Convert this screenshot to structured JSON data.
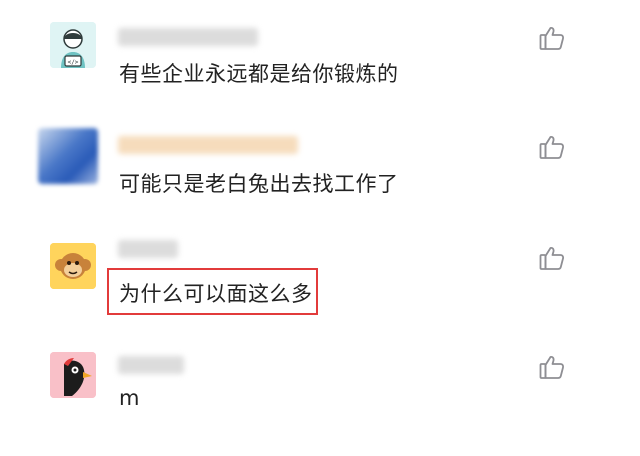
{
  "comments": [
    {
      "text": "有些企业永远都是给你锻炼的",
      "avatar_icon": "programmer-avatar-icon",
      "like_icon": "thumbs-up-icon"
    },
    {
      "text": "可能只是老白兔出去找工作了",
      "avatar_icon": "blurred-avatar-icon",
      "like_icon": "thumbs-up-icon"
    },
    {
      "text": "为什么可以面这么多",
      "avatar_icon": "monkey-avatar-icon",
      "like_icon": "thumbs-up-icon",
      "highlighted": true
    },
    {
      "text": "m",
      "avatar_icon": "woodpecker-avatar-icon",
      "like_icon": "thumbs-up-icon"
    }
  ],
  "colors": {
    "text": "#222222",
    "like_icon": "#8e8e93",
    "highlight_box": "#e23b3b",
    "name_blur_gray": "#d9d9d9",
    "name_blur_peach": "#f6dcbc"
  }
}
